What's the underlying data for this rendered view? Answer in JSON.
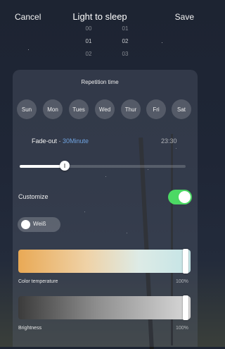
{
  "header": {
    "cancel_label": "Cancel",
    "title": "Light to sleep",
    "save_label": "Save"
  },
  "picker": {
    "hours": [
      "00",
      "01",
      "02"
    ],
    "minutes": [
      "01",
      "02",
      "03"
    ]
  },
  "repetition": {
    "title": "Repetition time",
    "days": [
      "Sun",
      "Mon",
      "Tues",
      "Wed",
      "Thur",
      "Fri",
      "Sat"
    ]
  },
  "fade": {
    "label": "Fade-out · ",
    "value": "30Minute",
    "time": "23:30",
    "level": 0.27
  },
  "customize": {
    "label": "Customize",
    "enabled": true,
    "toggle_color": "#4cd964"
  },
  "color_chip": {
    "label": "Weiß"
  },
  "color_temperature": {
    "label": "Color temperature",
    "value": "100%",
    "level": 1.0
  },
  "brightness": {
    "label": "Brightness",
    "value": "100%",
    "level": 1.0
  }
}
